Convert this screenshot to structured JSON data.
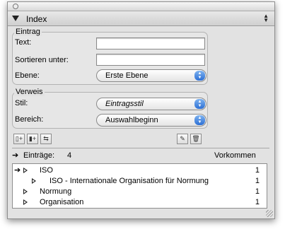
{
  "header": {
    "title": "Index",
    "menu_icon": "popup-arrows-icon"
  },
  "entry_group": {
    "title": "Eintrag",
    "text_label": "Text:",
    "text_value": "",
    "sort_label": "Sortieren unter:",
    "sort_value": "",
    "level_label": "Ebene:",
    "level_value": "Erste Ebene"
  },
  "ref_group": {
    "title": "Verweis",
    "style_label": "Stil:",
    "style_value": "Eintragsstil",
    "range_label": "Bereich:",
    "range_value": "Auswahlbeginn"
  },
  "toolbar_icons": [
    "add-entry-icon",
    "add-reference-icon",
    "edit-reference-icon",
    "edit-pencil-icon",
    "trash-icon"
  ],
  "entries_summary": {
    "label": "Einträge:",
    "count": "4",
    "occurrences_label": "Vorkommen"
  },
  "entries": [
    {
      "text": "ISO",
      "count": "1"
    },
    {
      "text": "ISO - Internationale Organisation für Normung",
      "count": "1"
    },
    {
      "text": "Normung",
      "count": "1"
    },
    {
      "text": "Organisation",
      "count": "1"
    }
  ]
}
